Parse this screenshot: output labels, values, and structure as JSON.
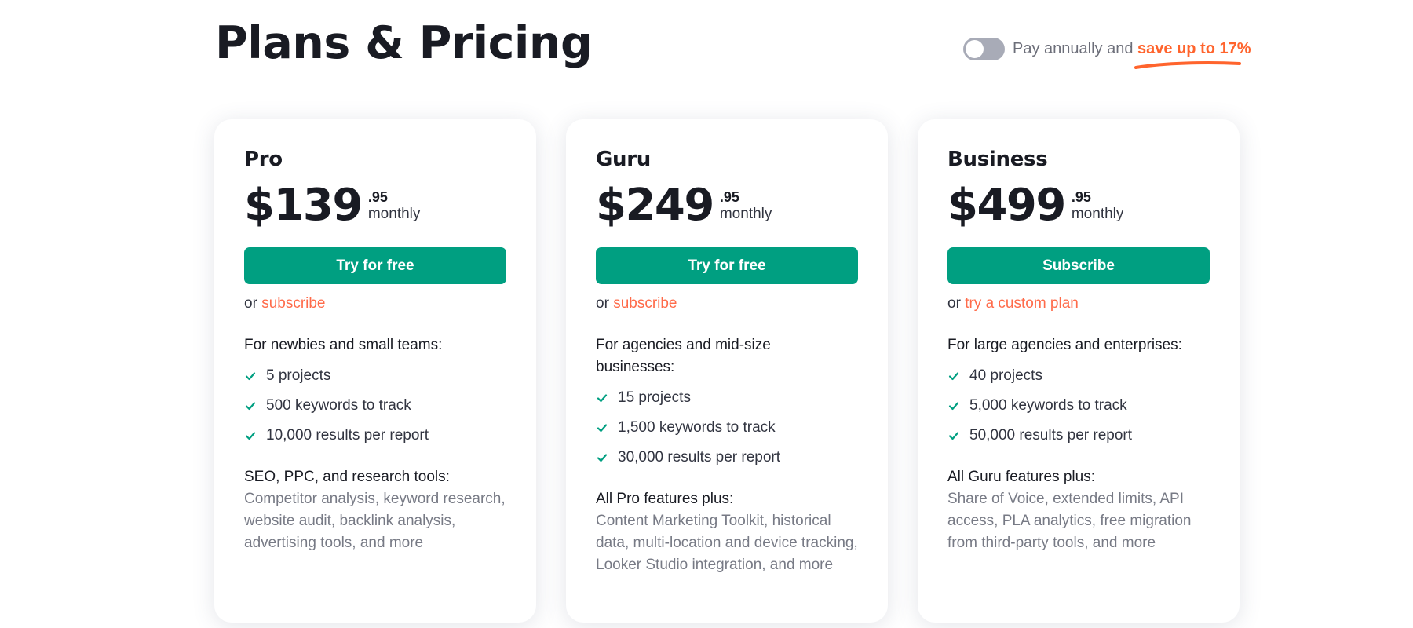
{
  "header": {
    "title": "Plans & Pricing",
    "toggle": {
      "state": "off",
      "label_prefix": "Pay annually and ",
      "label_highlight": "save up to 17%"
    }
  },
  "colors": {
    "accent_green": "#009f81",
    "accent_orange": "#ff642d",
    "link_orange": "#ff6b4a",
    "toggle_off": "#a8abb7"
  },
  "plans": [
    {
      "name": "Pro",
      "price_whole": "$139",
      "price_cents": ".95",
      "period": "monthly",
      "cta_label": "Try for free",
      "alt_prefix": "or ",
      "alt_link": "subscribe",
      "audience": "For newbies and small teams:",
      "features": [
        {
          "icon": "check-icon",
          "text": "5 projects"
        },
        {
          "icon": "check-icon",
          "text": "500 keywords to track"
        },
        {
          "icon": "check-icon",
          "text": "10,000 results per report"
        }
      ],
      "extras_title": "SEO, PPC, and research tools:",
      "extras_desc": "Competitor analysis, keyword research, website audit, backlink analysis, advertising tools, and more"
    },
    {
      "name": "Guru",
      "price_whole": "$249",
      "price_cents": ".95",
      "period": "monthly",
      "cta_label": "Try for free",
      "alt_prefix": "or ",
      "alt_link": "subscribe",
      "audience": "For agencies and mid-size businesses:",
      "features": [
        {
          "icon": "check-icon",
          "text": "15 projects"
        },
        {
          "icon": "check-icon",
          "text": "1,500 keywords to track"
        },
        {
          "icon": "check-icon",
          "text": "30,000 results per report"
        }
      ],
      "extras_title": "All Pro features plus:",
      "extras_desc": "Content Marketing Toolkit, historical data, multi-location and device tracking, Looker Studio integration, and more"
    },
    {
      "name": "Business",
      "price_whole": "$499",
      "price_cents": ".95",
      "period": "monthly",
      "cta_label": "Subscribe",
      "alt_prefix": "or ",
      "alt_link": "try a custom plan",
      "audience": "For large agencies and enterprises:",
      "features": [
        {
          "icon": "check-icon",
          "text": "40 projects"
        },
        {
          "icon": "check-icon",
          "text": "5,000 keywords to track"
        },
        {
          "icon": "check-icon",
          "text": "50,000 results per report"
        }
      ],
      "extras_title": "All Guru features plus:",
      "extras_desc": "Share of Voice, extended limits, API access, PLA analytics, free migration from third-party tools, and more"
    }
  ]
}
